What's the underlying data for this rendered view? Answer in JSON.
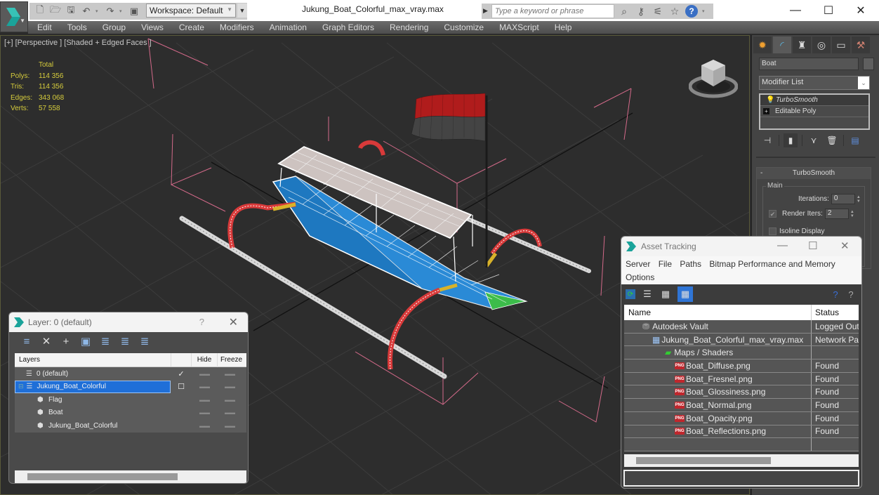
{
  "titlebar": {
    "workspace": "Workspace: Default",
    "document_title": "Jukung_Boat_Colorful_max_vray.max",
    "search_placeholder": "Type a keyword or phrase",
    "help_label": "?",
    "window_controls": {
      "minimize": "—",
      "maximize": "☐",
      "close": "✕"
    }
  },
  "menubar": {
    "items": [
      "Edit",
      "Tools",
      "Group",
      "Views",
      "Create",
      "Modifiers",
      "Animation",
      "Graph Editors",
      "Rendering",
      "Customize",
      "MAXScript",
      "Help"
    ]
  },
  "viewport": {
    "label": "[+] [Perspective ] [Shaded + Edged Faces ]",
    "stats": {
      "header": "Total",
      "rows": [
        {
          "key": "Polys:",
          "value": "114 356"
        },
        {
          "key": "Tris:",
          "value": "114 356"
        },
        {
          "key": "Edges:",
          "value": "343 068"
        },
        {
          "key": "Verts:",
          "value": "57 558"
        }
      ]
    }
  },
  "command_panel": {
    "tabs": [
      "create-icon",
      "modify-icon",
      "hierarchy-icon",
      "motion-icon",
      "display-icon",
      "utilities-icon"
    ],
    "object_name": "Boat",
    "modifier_list_label": "Modifier List",
    "stack": [
      {
        "label": "TurboSmooth",
        "selected": true
      },
      {
        "label": "Editable Poly",
        "selected": false
      }
    ],
    "rollout": {
      "title": "TurboSmooth",
      "collapse": "-",
      "group": "Main",
      "iterations_label": "Iterations:",
      "iterations_value": "0",
      "render_iters_label": "Render Iters:",
      "render_iters_value": "2",
      "render_iters_checked": true,
      "isoline_label": "Isoline Display",
      "isoline_checked": false
    }
  },
  "layer_window": {
    "title": "Layer: 0 (default)",
    "help": "?",
    "close": "✕",
    "columns": {
      "layers": "Layers",
      "hide": "Hide",
      "freeze": "Freeze"
    },
    "rows": [
      {
        "name": "0 (default)",
        "type": "layer",
        "indent": 1,
        "current": "✓",
        "selected": false
      },
      {
        "name": "Jukung_Boat_Colorful",
        "type": "layer",
        "indent": 0,
        "current": "☐",
        "selected": true
      },
      {
        "name": "Flag",
        "type": "object",
        "indent": 2,
        "current": "",
        "selected": false
      },
      {
        "name": "Boat",
        "type": "object",
        "indent": 2,
        "current": "",
        "selected": false
      },
      {
        "name": "Jukung_Boat_Colorful",
        "type": "object",
        "indent": 2,
        "current": "",
        "selected": false
      }
    ],
    "dash": "▬▬"
  },
  "asset_window": {
    "title": "Asset Tracking",
    "menu": [
      "Server",
      "File",
      "Paths",
      "Bitmap Performance and Memory",
      "Options"
    ],
    "columns": {
      "name": "Name",
      "status": "Status"
    },
    "rows": [
      {
        "name": "Autodesk Vault",
        "status": "Logged Out",
        "icon": "vault",
        "indent": 1
      },
      {
        "name": "Jukung_Boat_Colorful_max_vray.max",
        "status": "Network Pat",
        "icon": "max",
        "indent": 2
      },
      {
        "name": "Maps / Shaders",
        "status": "",
        "icon": "maps",
        "indent": 3
      },
      {
        "name": "Boat_Diffuse.png",
        "status": "Found",
        "icon": "png",
        "indent": 4
      },
      {
        "name": "Boat_Fresnel.png",
        "status": "Found",
        "icon": "png",
        "indent": 4
      },
      {
        "name": "Boat_Glossiness.png",
        "status": "Found",
        "icon": "png",
        "indent": 4
      },
      {
        "name": "Boat_Normal.png",
        "status": "Found",
        "icon": "png",
        "indent": 4
      },
      {
        "name": "Boat_Opacity.png",
        "status": "Found",
        "icon": "png",
        "indent": 4
      },
      {
        "name": "Boat_Reflections.png",
        "status": "Found",
        "icon": "png",
        "indent": 4
      },
      {
        "name": "",
        "status": "",
        "icon": "",
        "indent": 0
      }
    ],
    "png_badge": "PNG"
  }
}
